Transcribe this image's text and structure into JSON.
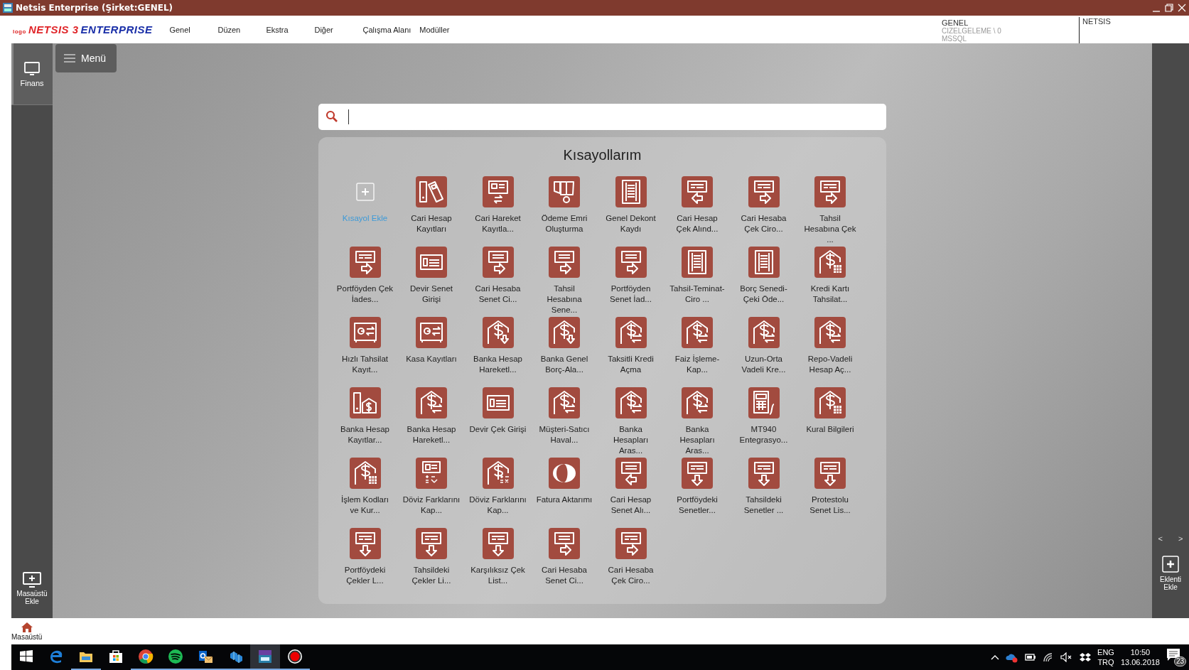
{
  "window": {
    "title": "Netsis Enterprise (Şirket:GENEL)"
  },
  "logo": {
    "prefix": "logo",
    "name": "NETSIS 3",
    "edition": "ENTERPRISE"
  },
  "menu": [
    "Genel",
    "Düzen",
    "Ekstra",
    "Diğer",
    "Çalışma Alanı",
    "Modüller"
  ],
  "company": {
    "name": "GENEL",
    "database": "CIZELGELEME \\ 0",
    "server": "MSSQL",
    "user": "NETSIS"
  },
  "sidebar": {
    "items": [
      {
        "label": "Finans",
        "selected": true
      }
    ],
    "add_desktop": "Masaüstü Ekle"
  },
  "menu_button": "Menü",
  "shortcuts": {
    "title": "Kısayollarım",
    "items": [
      {
        "label": "Kısayol Ekle",
        "kind": "add"
      },
      {
        "label": "Cari Hesap Kayıtları",
        "kind": "binder-card"
      },
      {
        "label": "Cari Hareket Kayıtla...",
        "kind": "card-swap"
      },
      {
        "label": "Ödeme Emri Oluşturma",
        "kind": "docs-cycle"
      },
      {
        "label": "Genel Dekont Kaydı",
        "kind": "ledger"
      },
      {
        "label": "Cari Hesap Çek Alınd...",
        "kind": "check-left"
      },
      {
        "label": "Cari Hesaba Çek Ciro...",
        "kind": "check-right"
      },
      {
        "label": "Tahsil Hesabına Çek ...",
        "kind": "check-right"
      },
      {
        "label": "Portföyden Çek İades...",
        "kind": "check-right"
      },
      {
        "label": "Devir Senet Girişi",
        "kind": "card"
      },
      {
        "label": "Cari Hesaba Senet Ci...",
        "kind": "note-right"
      },
      {
        "label": "Tahsil Hesabına Sene...",
        "kind": "note-right"
      },
      {
        "label": "Portföyden Senet İad...",
        "kind": "note-right"
      },
      {
        "label": "Tahsil-Teminat-Ciro ...",
        "kind": "ledger"
      },
      {
        "label": "Borç Senedi-Çeki Öde...",
        "kind": "ledger"
      },
      {
        "label": "Kredi Kartı Tahsilat...",
        "kind": "bank-calc"
      },
      {
        "label": "Hızlı Tahsilat Kayıt...",
        "kind": "safe-swap"
      },
      {
        "label": "Kasa Kayıtları",
        "kind": "safe-swap"
      },
      {
        "label": "Banka Hesap Hareketl...",
        "kind": "bank-down"
      },
      {
        "label": "Banka Genel Borç-Ala...",
        "kind": "bank-down"
      },
      {
        "label": "Taksitli Kredi Açma",
        "kind": "bank-swap"
      },
      {
        "label": "Faiz İşleme-Kap...",
        "kind": "bank-swap"
      },
      {
        "label": "Uzun-Orta Vadeli Kre...",
        "kind": "bank-swap"
      },
      {
        "label": "Repo-Vadeli Hesap Aç...",
        "kind": "bank-swap"
      },
      {
        "label": "Banka Hesap Kayıtlar...",
        "kind": "binder-bank"
      },
      {
        "label": "Banka Hesap Hareketl...",
        "kind": "bank-swap"
      },
      {
        "label": "Devir Çek Girişi",
        "kind": "card"
      },
      {
        "label": "Müşteri-Satıcı Haval...",
        "kind": "bank-swap"
      },
      {
        "label": "Banka Hesapları Aras...",
        "kind": "bank-swap"
      },
      {
        "label": "Banka Hesapları Aras...",
        "kind": "bank-swap"
      },
      {
        "label": "MT940 Entegrasyo...",
        "kind": "calc-curve"
      },
      {
        "label": "Kural Bilgileri",
        "kind": "bank-calc"
      },
      {
        "label": "İşlem Kodları ve Kur...",
        "kind": "bank-calc"
      },
      {
        "label": "Döviz Farklarını Kap...",
        "kind": "card-math"
      },
      {
        "label": "Döviz Farklarını Kap...",
        "kind": "bank-math"
      },
      {
        "label": "Fatura Aktarımı",
        "kind": "round-logo"
      },
      {
        "label": "Cari Hesap Senet Alı...",
        "kind": "note-left"
      },
      {
        "label": "Portföydeki Senetler...",
        "kind": "check-down"
      },
      {
        "label": "Tahsildeki Senetler ...",
        "kind": "check-down"
      },
      {
        "label": "Protestolu Senet Lis...",
        "kind": "check-down"
      },
      {
        "label": "Portföydeki Çekler L...",
        "kind": "check-down"
      },
      {
        "label": "Tahsildeki Çekler Li...",
        "kind": "check-down"
      },
      {
        "label": "Karşılıksız Çek List...",
        "kind": "check-down"
      },
      {
        "label": "Cari Hesaba Senet Ci...",
        "kind": "note-right"
      },
      {
        "label": "Cari Hesaba Çek Ciro...",
        "kind": "check-right"
      }
    ]
  },
  "right_panel": {
    "prev": "<",
    "next": ">",
    "add_plugin": "Eklenti Ekle"
  },
  "bottom_tabs": [
    {
      "label": "Masaüstü",
      "selected": true
    }
  ],
  "taskbar": {
    "apps": [
      {
        "kind": "start",
        "running": false,
        "active": false
      },
      {
        "kind": "browser",
        "running": false,
        "active": false
      },
      {
        "kind": "folder",
        "running": true,
        "active": false
      },
      {
        "kind": "store",
        "running": false,
        "active": false
      },
      {
        "kind": "chrome",
        "running": true,
        "active": false
      },
      {
        "kind": "music",
        "running": true,
        "active": false
      },
      {
        "kind": "mail",
        "running": true,
        "active": false
      },
      {
        "kind": "cubes",
        "running": true,
        "active": false
      },
      {
        "kind": "netsis",
        "running": true,
        "active": true
      },
      {
        "kind": "record",
        "running": true,
        "active": false
      }
    ],
    "language": "ENG",
    "layout": "TRQ",
    "time": "10:50",
    "date": "13.06.2018",
    "notifications": "23"
  }
}
